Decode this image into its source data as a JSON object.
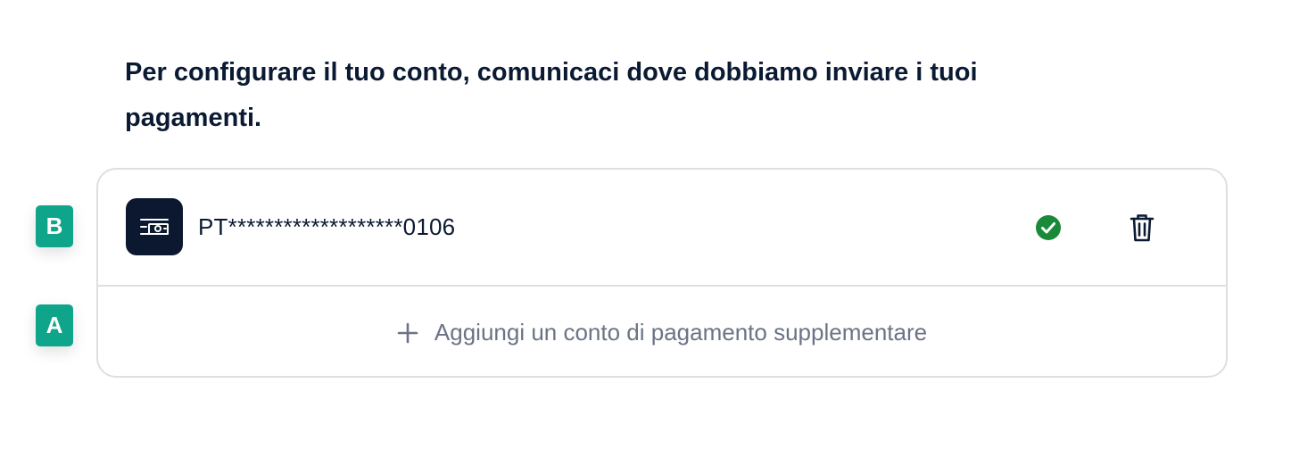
{
  "heading": "Per configurare il tuo conto, comunicaci dove dobbiamo inviare i tuoi pagamenti.",
  "account": {
    "icon": "bank-transfer-icon",
    "masked_number": "PT*******************0106",
    "status_icon": "check-circle-icon",
    "status": "verified",
    "delete_icon": "trash-icon"
  },
  "add_account": {
    "icon": "plus-icon",
    "label": "Aggiungi un conto di pagamento supplementare"
  },
  "badges": {
    "b": "B",
    "a": "A"
  },
  "colors": {
    "text_primary": "#0b1a33",
    "text_muted": "#6b7385",
    "icon_bg": "#0c1830",
    "success": "#1a8a3a",
    "badge": "#0ea58b",
    "border": "#dedfe3"
  }
}
